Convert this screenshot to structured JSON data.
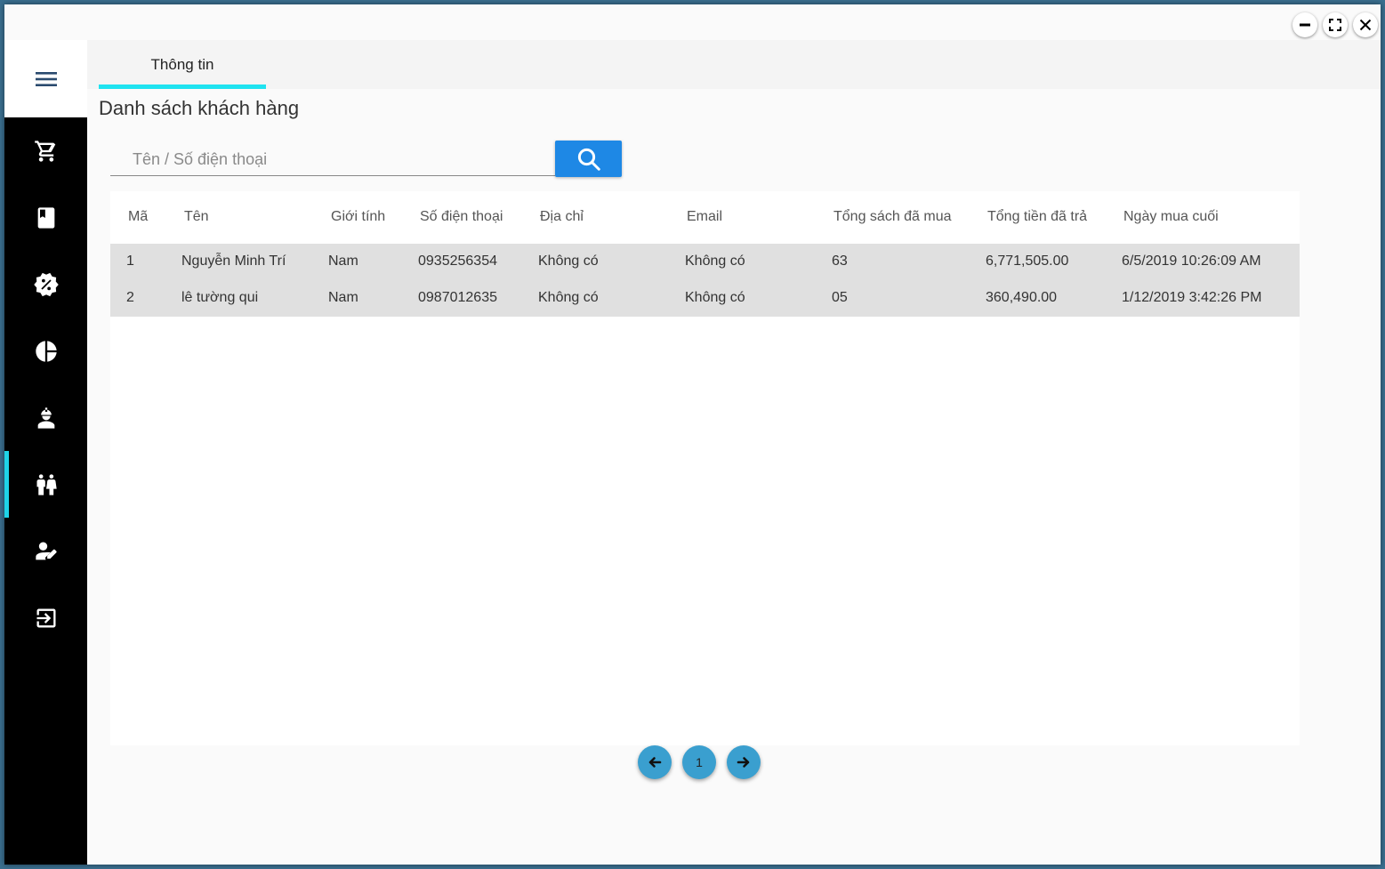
{
  "window": {
    "controls": [
      "minimize-icon",
      "maximize-icon",
      "close-icon"
    ]
  },
  "sidebar": {
    "toggle_icon": "menu-icon",
    "items": [
      {
        "name": "cart",
        "icon": "shopping-cart-icon",
        "active": false
      },
      {
        "name": "books",
        "icon": "book-icon",
        "active": false
      },
      {
        "name": "discount",
        "icon": "discount-badge-icon",
        "active": false
      },
      {
        "name": "report",
        "icon": "pie-chart-icon",
        "active": false
      },
      {
        "name": "employee",
        "icon": "worker-icon",
        "active": false
      },
      {
        "name": "customers",
        "icon": "people-icon",
        "active": true
      },
      {
        "name": "account",
        "icon": "user-edit-icon",
        "active": false
      },
      {
        "name": "logout",
        "icon": "logout-icon",
        "active": false
      }
    ],
    "accent_color": "#1fd3e8"
  },
  "tabs": [
    {
      "label": "Thông tin",
      "active": true
    }
  ],
  "page": {
    "title": "Danh sách khách hàng"
  },
  "search": {
    "placeholder": "Tên / Số điện thoại",
    "value": "",
    "button_icon": "search-icon",
    "button_color": "#1e88e5"
  },
  "table": {
    "columns": [
      "Mã",
      "Tên",
      "Giới tính",
      "Số điện thoại",
      "Địa chỉ",
      "Email",
      "Tổng sách đã mua",
      "Tổng tiền đã trả",
      "Ngày mua cuối"
    ],
    "rows": [
      [
        "1",
        "Nguyễn Minh Trí",
        "Nam",
        "0935256354",
        "Không có",
        "Không có",
        "63",
        "6,771,505.00",
        "6/5/2019 10:26:09 AM"
      ],
      [
        "2",
        "lê tường qui",
        "Nam",
        "0987012635",
        "Không có",
        "Không có",
        "05",
        "360,490.00",
        "1/12/2019 3:42:26 PM"
      ]
    ]
  },
  "pagination": {
    "prev_icon": "arrow-left-icon",
    "current_page": "1",
    "next_icon": "arrow-right-icon",
    "color": "#3a9fcf"
  }
}
